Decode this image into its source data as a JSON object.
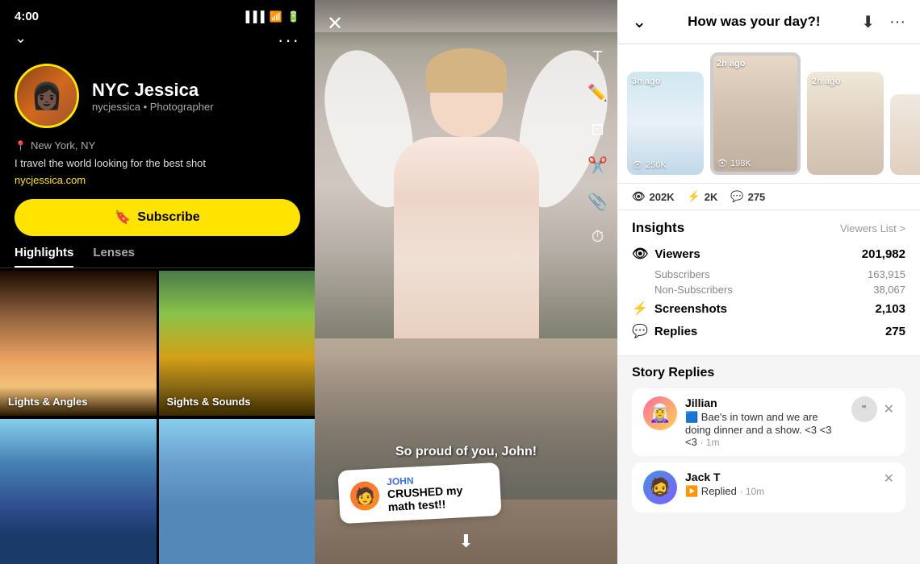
{
  "left": {
    "time": "4:00",
    "username_display": "NYC Jessica",
    "username_handle": "nycjessica • Photographer",
    "location": "New York, NY",
    "bio": "I travel the world looking for the best shot",
    "website": "nycjessica.com",
    "subscribe_label": "Subscribe",
    "tabs": [
      "Highlights",
      "Lenses"
    ],
    "highlights": [
      {
        "label": "Lights & Angles"
      },
      {
        "label": "Sights & Sounds"
      },
      {
        "label": ""
      },
      {
        "label": ""
      }
    ]
  },
  "middle": {
    "close_icon": "✕",
    "caption": "So proud of you, John!",
    "sticker_name": "JOHN",
    "sticker_msg": "CRUSHED my math test!!"
  },
  "right": {
    "title": "How was your day?!",
    "download_icon": "⬇",
    "more_icon": "•••",
    "thumbnails": [
      {
        "time": "3h ago",
        "views": "250K"
      },
      {
        "time": "2h ago",
        "views": "198K"
      },
      {
        "time": "2h ago",
        "views": ""
      }
    ],
    "stats": {
      "views": "202K",
      "screenshots": "2K",
      "replies": "275"
    },
    "insights": {
      "title": "Insights",
      "viewers_list": "Viewers List >",
      "viewers_label": "Viewers",
      "viewers_count": "201,982",
      "subscribers_label": "Subscribers",
      "subscribers_count": "163,915",
      "non_subscribers_label": "Non-Subscribers",
      "non_subscribers_count": "38,067",
      "screenshots_label": "Screenshots",
      "screenshots_count": "2,103",
      "replies_label": "Replies",
      "replies_count": "275"
    },
    "story_replies": {
      "title": "Story Replies",
      "replies": [
        {
          "name": "Jillian",
          "msg": "Bae's in town and we are doing dinner and a show. <3 <3 <3",
          "time": "1m",
          "has_quote": true
        },
        {
          "name": "Jack T",
          "msg": "Replied",
          "time": "10m",
          "has_quote": false
        }
      ]
    }
  }
}
